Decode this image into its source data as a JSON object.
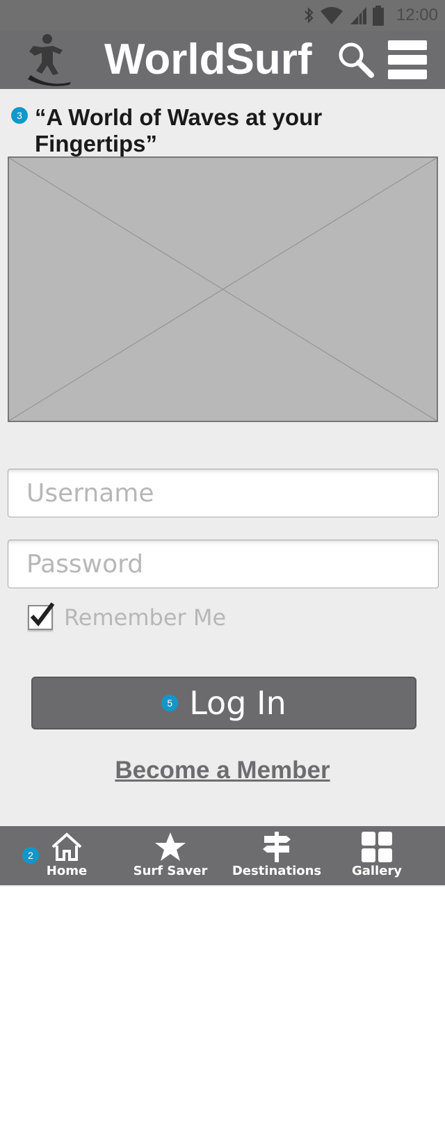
{
  "status_bar": {
    "time": "12:00",
    "icons": [
      "bluetooth-icon",
      "wifi-icon",
      "signal-icon",
      "battery-icon"
    ]
  },
  "header": {
    "title": "WorldSurf",
    "logo_icon": "surfer-logo-icon",
    "search_icon": "search-icon",
    "menu_icon": "hamburger-menu-icon"
  },
  "annotations": {
    "tagline_badge": "3",
    "login_badge": "5",
    "nav_badge": "2"
  },
  "tagline": "“A World of Waves at your Fingertips”",
  "hero": {
    "type": "image-placeholder"
  },
  "form": {
    "username_placeholder": "Username",
    "password_placeholder": "Password",
    "remember_label": "Remember Me",
    "remember_checked": true,
    "login_label": "Log In",
    "member_link": "Become a Member"
  },
  "bottom_nav": {
    "items": [
      {
        "label": "Home",
        "icon": "home-icon"
      },
      {
        "label": "Surf Saver",
        "icon": "star-icon"
      },
      {
        "label": "Destinations",
        "icon": "signpost-icon"
      },
      {
        "label": "Gallery",
        "icon": "grid-icon"
      }
    ]
  },
  "colors": {
    "header_bg": "#6d6d6f",
    "page_bg": "#ededed",
    "badge": "#1297c9",
    "button_bg": "#6b6b6e"
  }
}
